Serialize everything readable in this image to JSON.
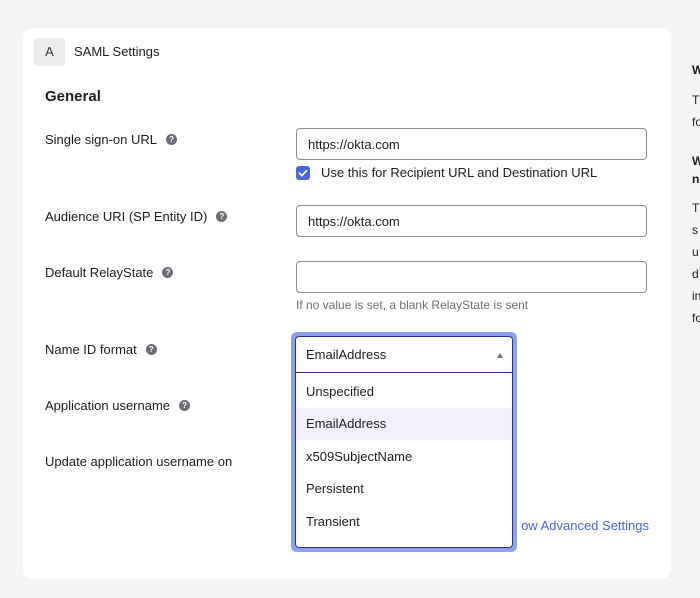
{
  "card": {
    "badge": "A",
    "title": "SAML Settings"
  },
  "section": {
    "title": "General"
  },
  "fields": {
    "sso_url": {
      "label": "Single sign-on URL",
      "value": "https://okta.com"
    },
    "recipient_checkbox": {
      "label": "Use this for Recipient URL and Destination URL",
      "checked": true
    },
    "audience_uri": {
      "label": "Audience URI (SP Entity ID)",
      "value": "https://okta.com"
    },
    "relay_state": {
      "label": "Default RelayState",
      "value": "",
      "hint": "If no value is set, a blank RelayState is sent"
    },
    "name_id_format": {
      "label": "Name ID format",
      "selected": "EmailAddress"
    },
    "app_username": {
      "label": "Application username"
    },
    "update_username": {
      "label": "Update application username on"
    }
  },
  "dropdown": {
    "options": [
      "Unspecified",
      "EmailAddress",
      "x509SubjectName",
      "Persistent",
      "Transient"
    ]
  },
  "advanced_link": "ow Advanced Settings",
  "right_panel": {
    "fragments": [
      "W",
      "T",
      "fo",
      "W",
      "n",
      "T",
      "s",
      "u",
      "d",
      "in",
      "fo"
    ]
  },
  "colors": {
    "accent": "#4c64d9",
    "focus_ring": "#8fa0ef"
  },
  "icons": {
    "help": "help-icon",
    "check": "check-icon",
    "caret": "caret-up-icon"
  }
}
